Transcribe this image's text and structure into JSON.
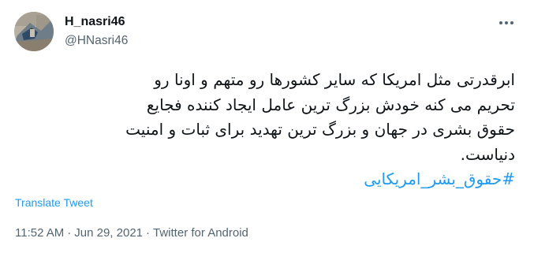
{
  "author": {
    "display_name": "H_nasri46",
    "handle": "@HNasri46",
    "avatar_icon": "profile-photo"
  },
  "more_icon": "more-horizontal-icon",
  "tweet": {
    "lines": [
      "ابرقدرتی مثل امریکا که سایر کشورها رو متهم و اونا رو",
      "تحریم می کنه خودش بزرگ ترین عامل ایجاد کننده فجایع",
      "حقوق بشری در جهان و بزرگ ترین تهدید برای ثبات و امنیت",
      "دنیاست."
    ],
    "hashtag": "#حقوق_بشر_امریکایی"
  },
  "translate_label": "Translate Tweet",
  "meta": {
    "time": "11:52 AM",
    "separator": "·",
    "date": "Jun 29, 2021",
    "source": "Twitter for Android"
  },
  "colors": {
    "link": "#1d9bf0",
    "secondary_text": "#536471",
    "primary_text": "#0f1419"
  }
}
